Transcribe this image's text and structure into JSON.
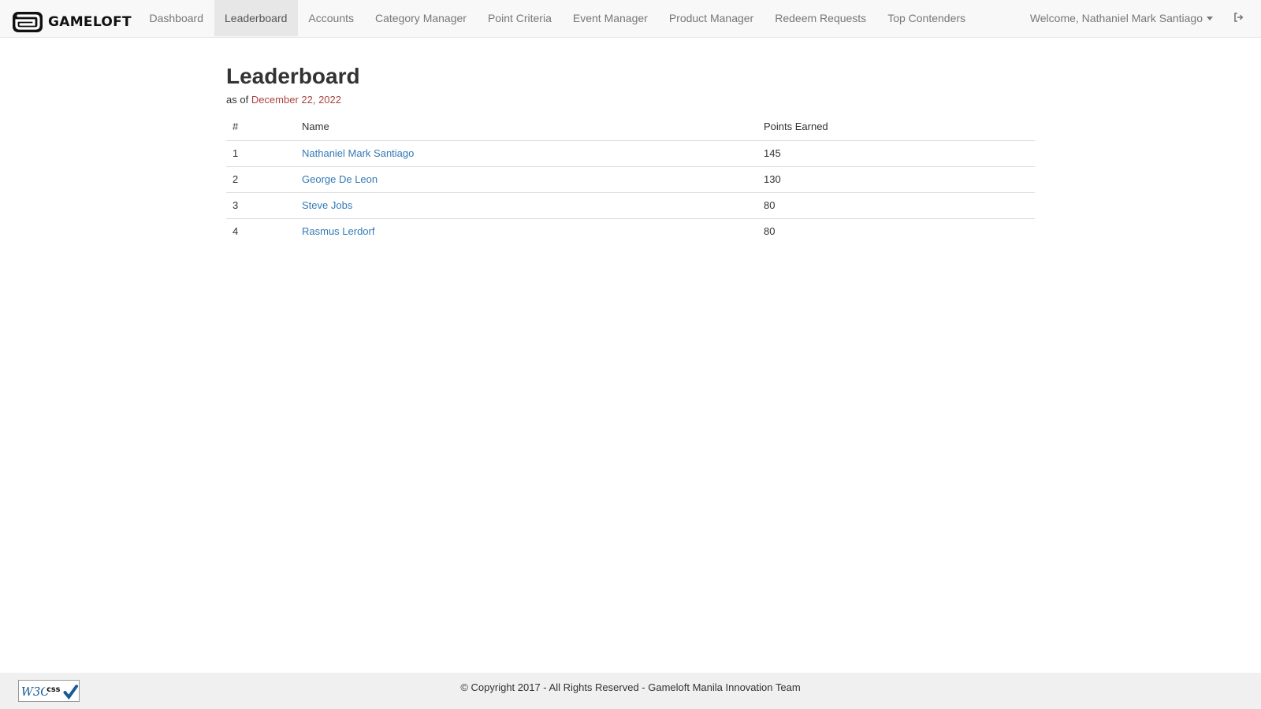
{
  "brand": {
    "name": "GAMELOFT"
  },
  "nav": {
    "items": [
      {
        "label": "Dashboard",
        "active": false
      },
      {
        "label": "Leaderboard",
        "active": true
      },
      {
        "label": "Accounts",
        "active": false
      },
      {
        "label": "Category Manager",
        "active": false
      },
      {
        "label": "Point Criteria",
        "active": false
      },
      {
        "label": "Event Manager",
        "active": false
      },
      {
        "label": "Product Manager",
        "active": false
      },
      {
        "label": "Redeem Requests",
        "active": false
      },
      {
        "label": "Top Contenders",
        "active": false
      }
    ],
    "welcome": "Welcome, Nathaniel Mark Santiago"
  },
  "page": {
    "title": "Leaderboard",
    "subtitle_prefix": "as of",
    "date": "December 22, 2022"
  },
  "table": {
    "headers": {
      "rank": "#",
      "name": "Name",
      "points": "Points Earned"
    },
    "rows": [
      {
        "rank": "1",
        "name": "Nathaniel Mark Santiago",
        "points": "145"
      },
      {
        "rank": "2",
        "name": "George De Leon",
        "points": "130"
      },
      {
        "rank": "3",
        "name": "Steve Jobs",
        "points": "80"
      },
      {
        "rank": "4",
        "name": "Rasmus Lerdorf",
        "points": "80"
      }
    ]
  },
  "footer": {
    "copyright": "© Copyright 2017 - All Rights Reserved - Gameloft Manila Innovation Team",
    "badge_text": "css"
  },
  "colors": {
    "link": "#337ab7",
    "date": "#a94442",
    "navbar_bg": "#f8f8f8",
    "active_tab_bg": "#e7e7e7"
  },
  "icons": {
    "logo": "gameloft-logo-icon",
    "caret": "caret-down-icon",
    "logout": "sign-out-icon",
    "badge": "w3c-css-badge-icon"
  }
}
